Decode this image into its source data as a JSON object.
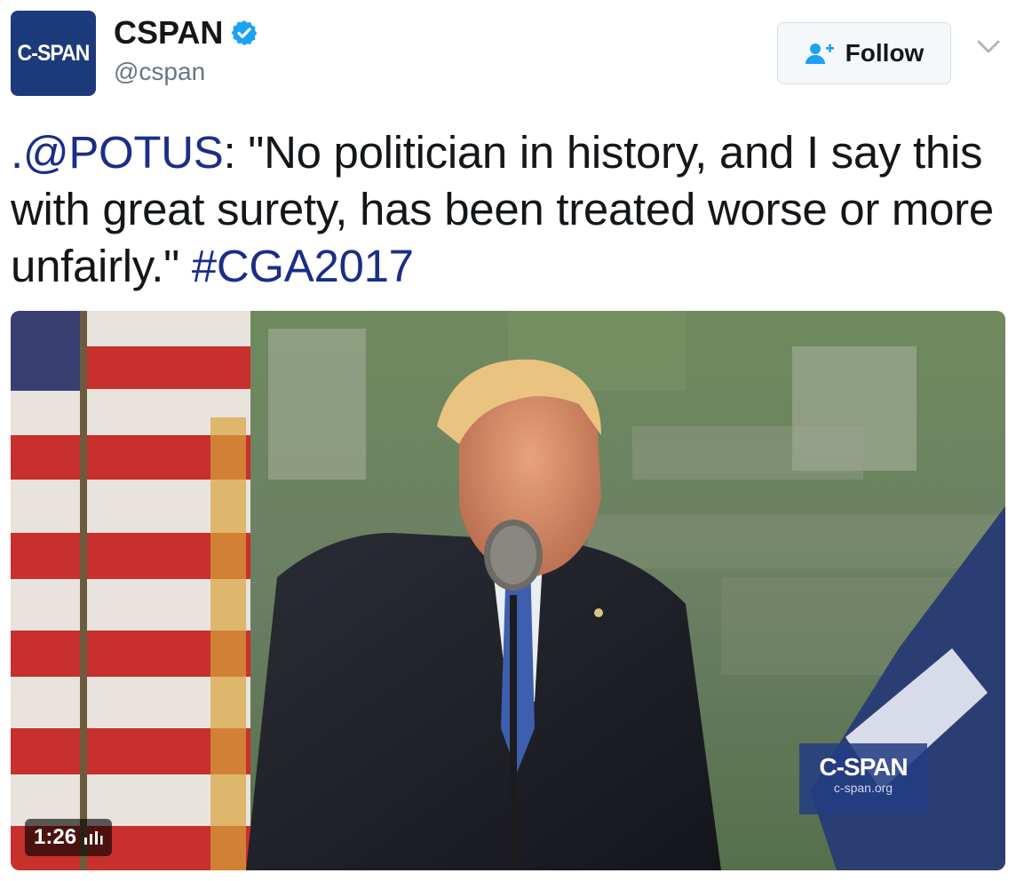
{
  "account": {
    "avatar_text": "C-SPAN",
    "display_name": "CSPAN",
    "handle": "@cspan",
    "verified": true
  },
  "follow_button": {
    "label": "Follow",
    "icon": "add-user-icon"
  },
  "menu_icon": "chevron-down-icon",
  "tweet": {
    "mention": ".@POTUS",
    "text_after_mention": ": \"No politician in history, and I say this with great surety, has been treated worse or more unfairly.\" ",
    "hashtag": "#CGA2017"
  },
  "media": {
    "type": "video",
    "duration": "1:26",
    "watermark_main": "C-SPAN",
    "watermark_sub": "c-span.org"
  },
  "colors": {
    "link": "#1b2e86",
    "verified_badge": "#1da1f2",
    "follow_icon": "#1da1f2",
    "avatar_bg": "#1d3a7a",
    "handle": "#657786"
  }
}
